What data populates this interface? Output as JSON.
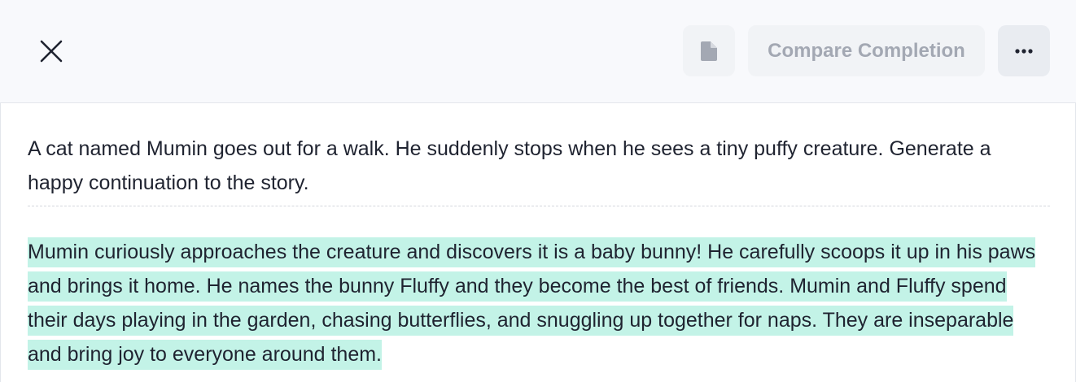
{
  "toolbar": {
    "close_icon": "close-icon",
    "document_icon": "document-icon",
    "compare_label": "Compare Completion",
    "more_icon": "more-horizontal-icon"
  },
  "content": {
    "prompt_text": "A cat named Mumin goes out for a walk. He suddenly stops when he sees a tiny puffy creature. Generate a happy continuation to the story.",
    "completion_text": "Mumin curiously approaches the creature and discovers it is a baby bunny! He carefully scoops it up in his paws and brings it home. He names the bunny Fluffy and they become the best of friends. Mumin and Fluffy spend their days playing in the garden, chasing butterflies, and snuggling up together for naps. They are inseparable and bring joy to everyone around them."
  },
  "colors": {
    "highlight": "#c3f3e7",
    "header_bg": "#f8f9fc",
    "button_bg": "#f1f3f6",
    "disabled_text": "#a3a8b3"
  }
}
